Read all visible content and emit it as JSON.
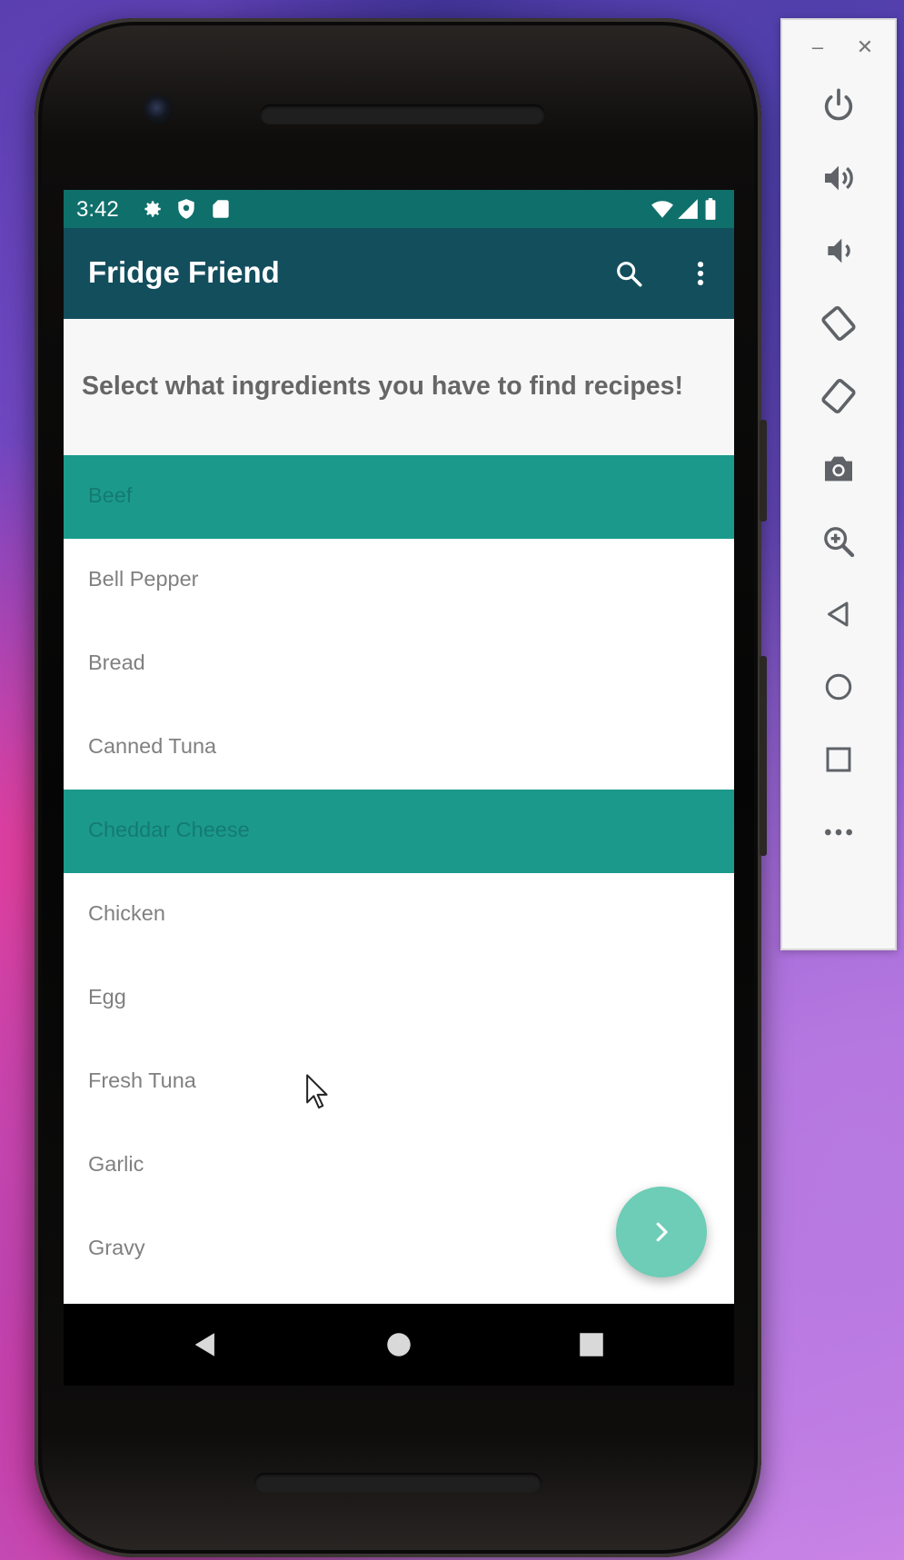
{
  "status_bar": {
    "time": "3:42"
  },
  "toolbar": {
    "title": "Fridge Friend",
    "search_icon": "search-icon",
    "more_icon": "more-vert-icon"
  },
  "header": {
    "instruction": "Select what ingredients you have to find recipes!"
  },
  "ingredients": [
    {
      "label": "Beef",
      "selected": true
    },
    {
      "label": "Bell Pepper",
      "selected": false
    },
    {
      "label": "Bread",
      "selected": false
    },
    {
      "label": "Canned Tuna",
      "selected": false
    },
    {
      "label": "Cheddar Cheese",
      "selected": true
    },
    {
      "label": "Chicken",
      "selected": false
    },
    {
      "label": "Egg",
      "selected": false
    },
    {
      "label": "Fresh Tuna",
      "selected": false
    },
    {
      "label": "Garlic",
      "selected": false
    },
    {
      "label": "Gravy",
      "selected": false
    }
  ],
  "fab": {
    "icon": "chevron-right-icon"
  },
  "nav_bar": {
    "buttons": [
      "back-icon",
      "home-icon",
      "recents-icon"
    ]
  },
  "emulator_panel": {
    "window_controls": [
      "minimize",
      "close"
    ],
    "window_glyphs": {
      "minimize": "–",
      "close": "✕"
    },
    "buttons": [
      "power-icon",
      "volume-up-icon",
      "volume-down-icon",
      "rotate-left-icon",
      "rotate-right-icon",
      "camera-icon",
      "zoom-icon",
      "back-icon",
      "home-icon",
      "overview-icon",
      "more-icon"
    ]
  },
  "colors": {
    "status_bar": "#0f6f6b",
    "toolbar": "#134e5d",
    "selected_row": "#1b9a8c",
    "selected_text": "#157a70",
    "fab": "#6dcdb6",
    "header_band": "#f7f7f7"
  }
}
